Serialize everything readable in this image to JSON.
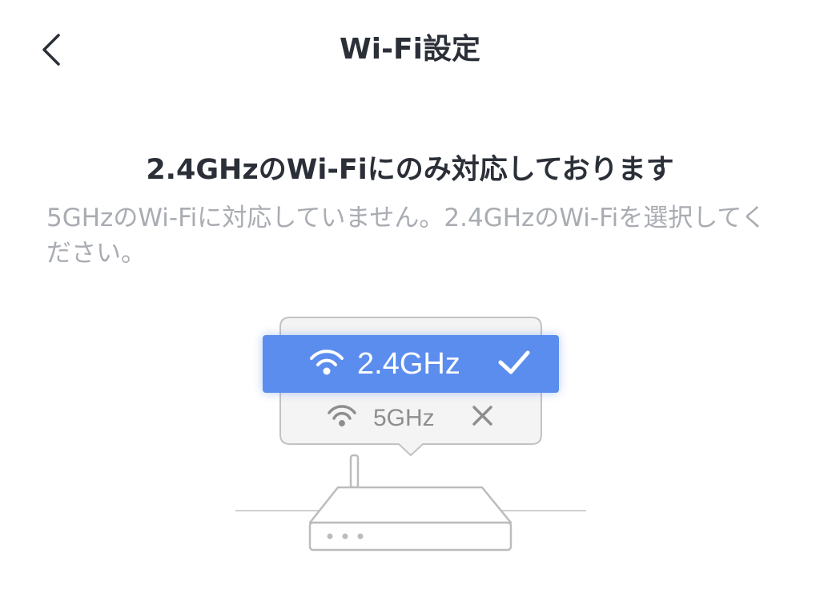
{
  "header": {
    "title": "Wi-Fi設定",
    "back_icon": "chevron-left-icon"
  },
  "main": {
    "headline": "2.4GHzのWi-Fiにのみ対応しております",
    "description": "5GHzのWi-Fiに対応していません。2.4GHzのWi-Fiを選択してください。"
  },
  "illustration": {
    "options": [
      {
        "label": "2.4GHz",
        "status_icon": "check-icon",
        "selected": true
      },
      {
        "label": "5GHz",
        "status_icon": "cross-icon",
        "selected": false
      }
    ],
    "device": "router-icon"
  },
  "colors": {
    "accent": "#5b8dee",
    "text": "#2b2f38",
    "muted": "#a9acb2",
    "line": "#b8b8b8"
  }
}
